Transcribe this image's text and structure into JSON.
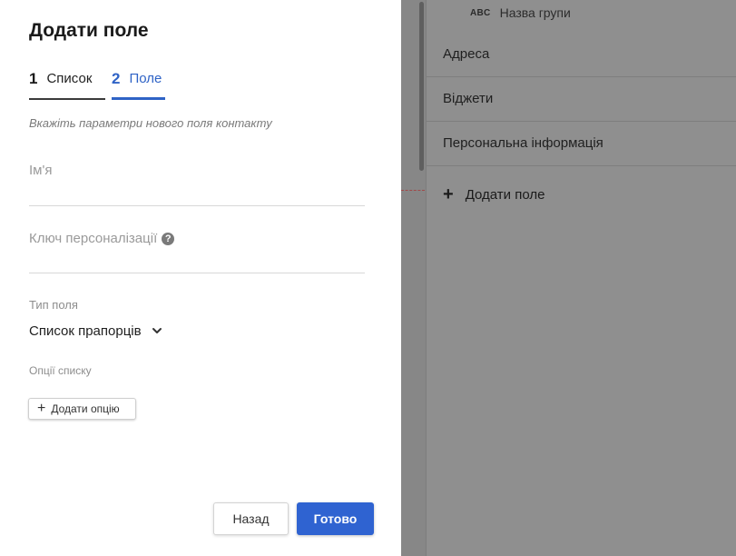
{
  "dialog": {
    "title": "Додати поле",
    "steps": [
      {
        "number": "1",
        "label": "Список"
      },
      {
        "number": "2",
        "label": "Поле"
      }
    ],
    "subtitle": "Вкажіть параметри нового поля контакту",
    "name_field": {
      "label": "Ім'я",
      "value": ""
    },
    "key_field": {
      "label": "Ключ персоналізації",
      "help_icon": "question-circle-icon",
      "value": ""
    },
    "field_type": {
      "label": "Тип поля",
      "selected": "Список прапорців"
    },
    "options": {
      "label": "Опції списку",
      "add_button": "Додати опцію"
    },
    "buttons": {
      "back": "Назад",
      "done": "Готово"
    }
  },
  "background": {
    "group_row": {
      "icon": "ABC",
      "label": "Назва групи"
    },
    "items": [
      "Адреса",
      "Віджети",
      "Персональна інформація"
    ],
    "add_field": "Додати поле"
  },
  "colors": {
    "accent": "#2f63d1",
    "overlay": "#8e8e8e",
    "panel": "#ffffff"
  }
}
